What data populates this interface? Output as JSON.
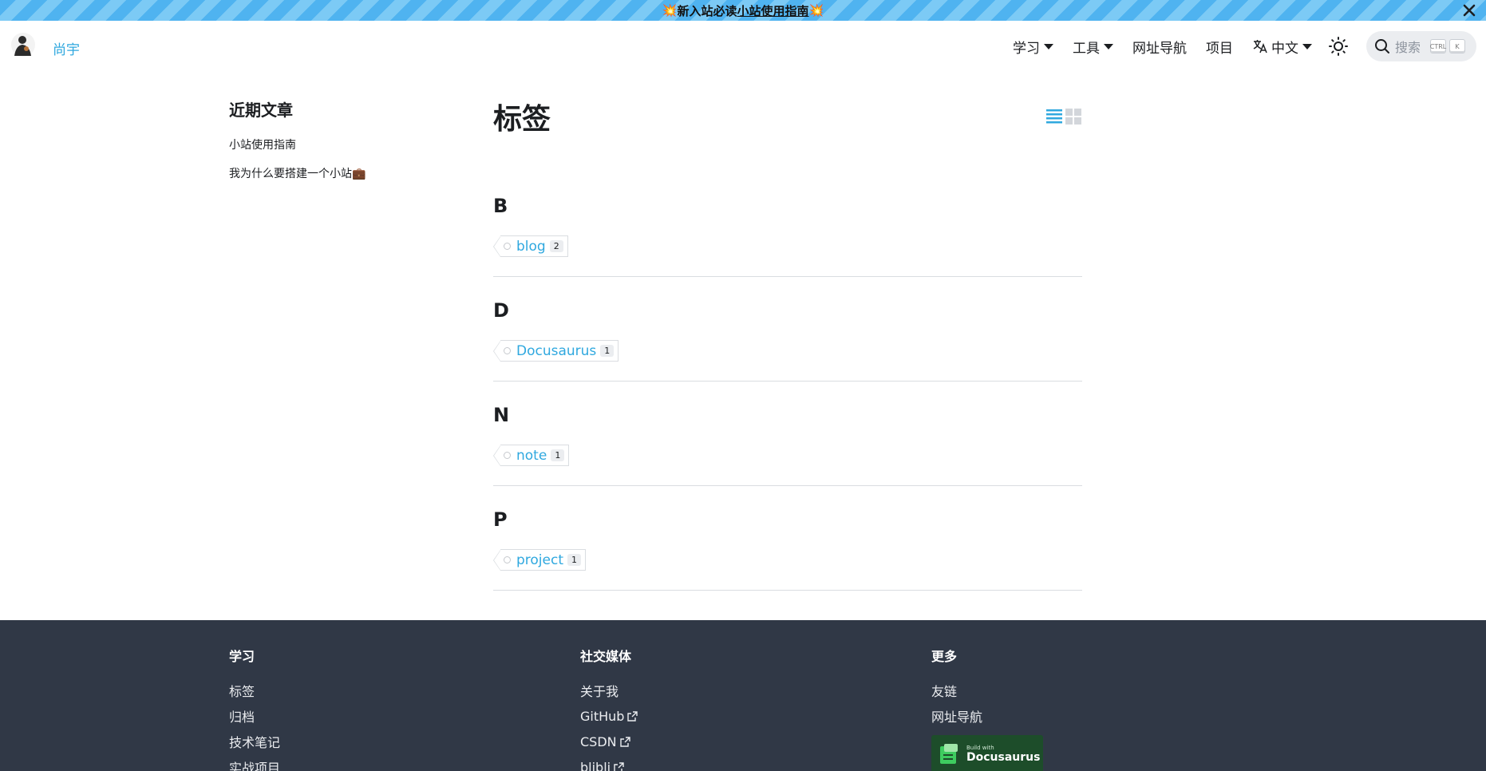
{
  "announcement": {
    "emoji_left": "💥",
    "text": "新入站必读",
    "link": "小站使用指南",
    "emoji_right": "💥"
  },
  "navbar": {
    "brand": "尚宇",
    "items": [
      "学习",
      "工具",
      "网址导航",
      "项目"
    ],
    "language": "中文",
    "search_placeholder": "搜索",
    "kbd": [
      "CTRL",
      "K"
    ]
  },
  "sidebar": {
    "title": "近期文章",
    "posts": [
      "小站使用指南",
      "我为什么要搭建一个小站💼"
    ]
  },
  "main": {
    "title": "标签",
    "groups": [
      {
        "letter": "B",
        "tag": "blog",
        "count": "2"
      },
      {
        "letter": "D",
        "tag": "Docusaurus",
        "count": "1"
      },
      {
        "letter": "N",
        "tag": "note",
        "count": "1"
      },
      {
        "letter": "P",
        "tag": "project",
        "count": "1"
      }
    ]
  },
  "footer": {
    "columns": [
      {
        "title": "学习",
        "links": [
          "标签",
          "归档",
          "技术笔记",
          "实战项目"
        ]
      },
      {
        "title": "社交媒体",
        "links": [
          "关于我",
          "GitHub",
          "CSDN",
          "blibli"
        ]
      },
      {
        "title": "更多",
        "links": [
          "友链",
          "网址导航"
        ]
      }
    ],
    "badge": {
      "small": "Build with",
      "big": "Docusaurus"
    }
  },
  "colors": {
    "accent": "#2fa8df",
    "footer_bg": "#303846",
    "announce_bg": "#4fb3f0"
  }
}
